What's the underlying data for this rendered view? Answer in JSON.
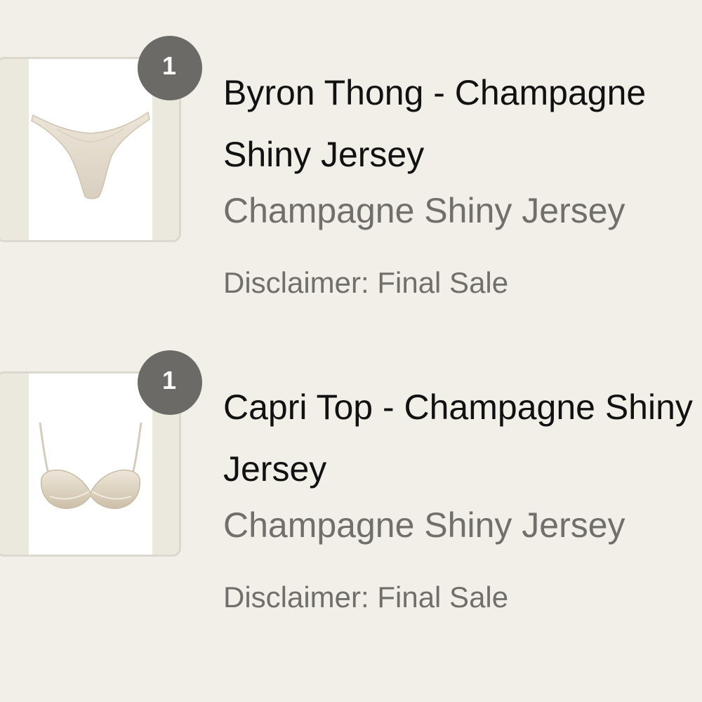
{
  "cart": {
    "items": [
      {
        "quantity": "1",
        "name": "Byron Thong - Champagne Shiny Jersey",
        "variant": "Champagne Shiny Jersey",
        "disclaimer": "Disclaimer: Final Sale",
        "image_icon": "thong-product-image"
      },
      {
        "quantity": "1",
        "name": "Capri Top - Champagne Shiny Jersey",
        "variant": "Champagne Shiny Jersey",
        "disclaimer": "Disclaimer: Final Sale",
        "image_icon": "bra-top-product-image"
      }
    ]
  },
  "colors": {
    "background": "#f2efe8",
    "badge": "#6b6a66",
    "product_fabric": "#e4dccd"
  }
}
